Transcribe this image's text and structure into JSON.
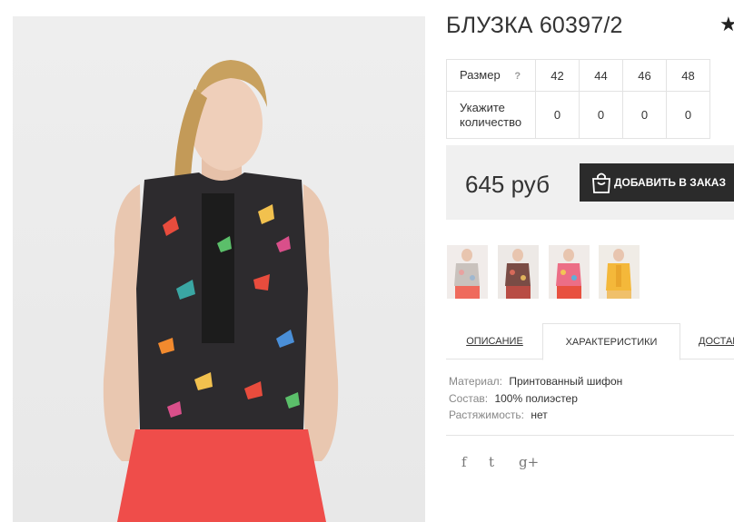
{
  "product": {
    "title": "БЛУЗКА 60397/2",
    "favorite_icon": "star-icon"
  },
  "sizes": {
    "row_label": "Размер",
    "help_icon": "?",
    "values": [
      "42",
      "44",
      "46",
      "48"
    ],
    "qty_label": "Укажите количество",
    "quantities": [
      "0",
      "0",
      "0",
      "0"
    ]
  },
  "purchase": {
    "price": "645 руб",
    "add_to_cart_label": "ДОБАВИТЬ В ЗАКАЗ",
    "button_color": "#2b2b2b"
  },
  "thumbnails": [
    {
      "name": "thumbnail-1"
    },
    {
      "name": "thumbnail-2"
    },
    {
      "name": "thumbnail-3"
    },
    {
      "name": "thumbnail-4"
    }
  ],
  "tabs": [
    {
      "label": "ОПИСАНИЕ",
      "active": false
    },
    {
      "label": "ХАРАКТЕРИСТИКИ",
      "active": true
    },
    {
      "label": "ДОСТАВКА",
      "active": false
    }
  ],
  "characteristics": [
    {
      "key": "Материал:",
      "value": "Принтованный шифон"
    },
    {
      "key": "Состав:",
      "value": "100% полиэстер"
    },
    {
      "key": "Растяжимость:",
      "value": "нет"
    }
  ],
  "social": {
    "facebook": "f",
    "twitter": "t",
    "google_plus": "g+"
  }
}
